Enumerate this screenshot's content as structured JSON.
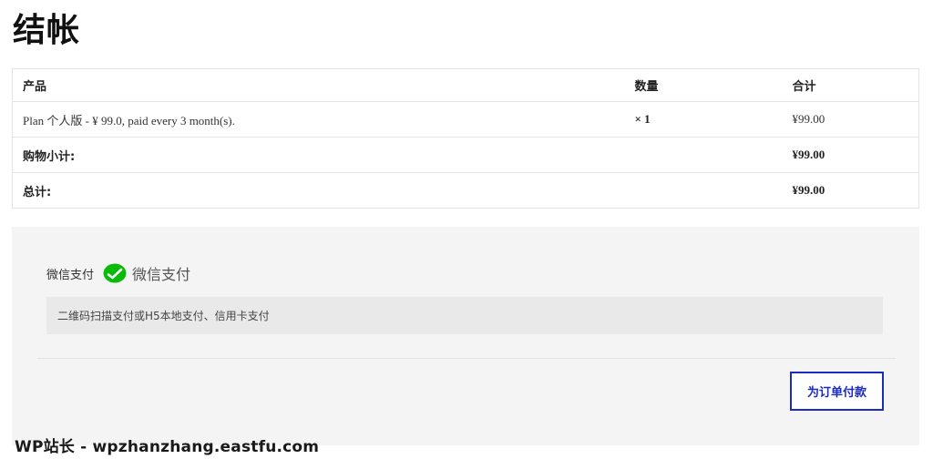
{
  "page": {
    "title": "结帐"
  },
  "order_table": {
    "headers": {
      "product": "产品",
      "quantity": "数量",
      "total": "合计"
    },
    "items": [
      {
        "product": "Plan 个人版 - ¥ 99.0, paid every 3 month(s).",
        "quantity": "× 1",
        "total": "¥99.00"
      }
    ],
    "subtotal": {
      "label": "购物小计:",
      "value": "¥99.00"
    },
    "grand_total": {
      "label": "总计:",
      "value": "¥99.00"
    }
  },
  "payment": {
    "method_label": "微信支付",
    "logo_text": "微信支付",
    "logo_icon": "wechat-pay-icon",
    "description": "二维码扫描支付或H5本地支付、信用卡支付",
    "place_order_label": "为订单付款"
  },
  "watermark": {
    "text": "WP站长 - wpzhanzhang.eastfu.com"
  },
  "colors": {
    "accent": "#1a2bbf",
    "wechat_green": "#09bb07",
    "panel_bg": "#f4f4f4"
  }
}
